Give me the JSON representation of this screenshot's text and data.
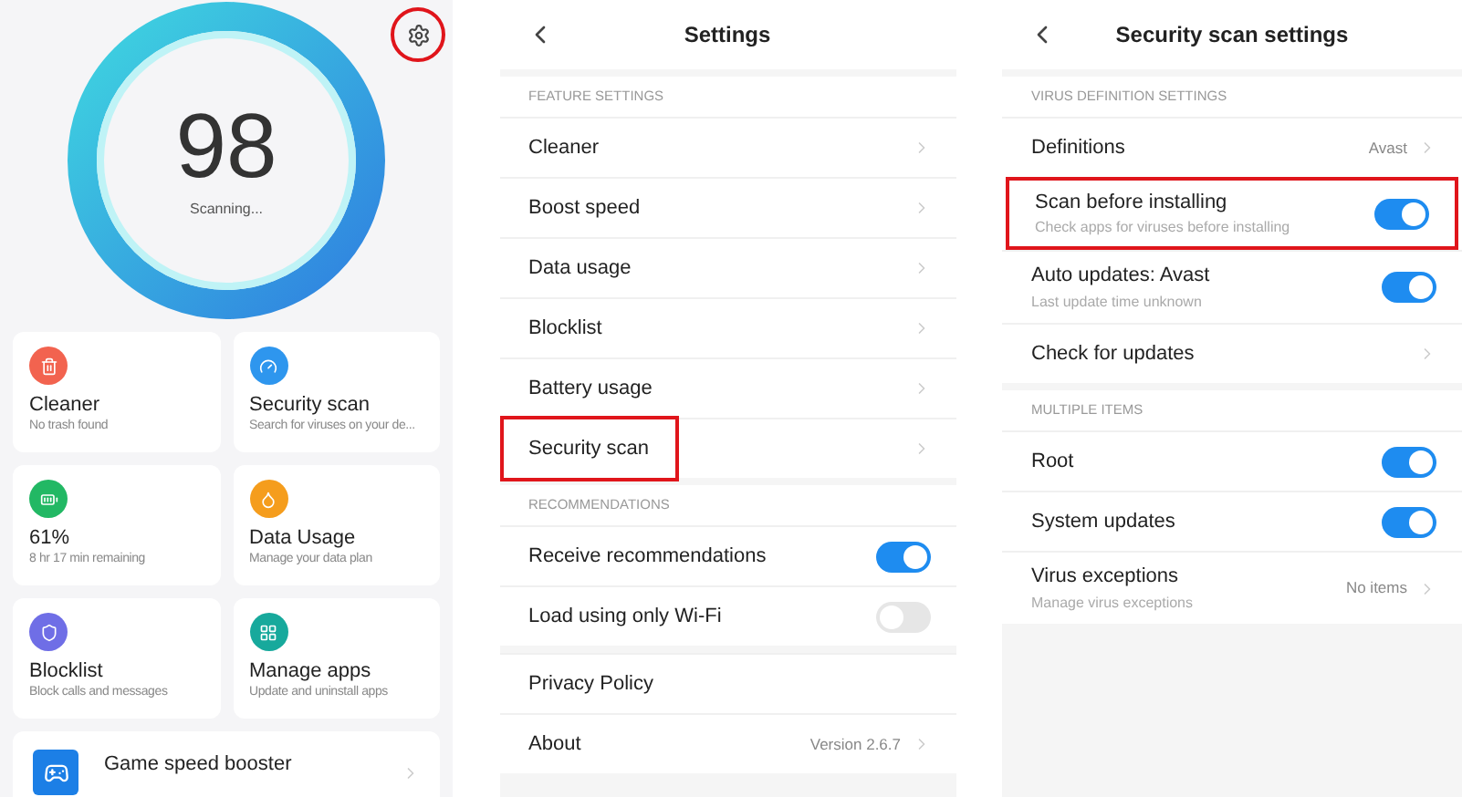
{
  "home": {
    "settings_highlighted": true,
    "score": "98",
    "status": "Scanning...",
    "tiles": [
      {
        "title": "Cleaner",
        "subtitle": "No trash found",
        "color": "#f2634f"
      },
      {
        "title": "Security scan",
        "subtitle": "Search for viruses on your de...",
        "color": "#2e96ee"
      },
      {
        "title": "61%",
        "subtitle": "8 hr 17 min  remaining",
        "color": "#22b864"
      },
      {
        "title": "Data Usage",
        "subtitle": "Manage your data plan",
        "color": "#f59d1d"
      },
      {
        "title": "Blocklist",
        "subtitle": "Block calls and messages",
        "color": "#6f6ee6"
      },
      {
        "title": "Manage apps",
        "subtitle": "Update and uninstall apps",
        "color": "#17a99c"
      }
    ],
    "booster": {
      "title": "Game speed booster"
    }
  },
  "settings": {
    "title": "Settings",
    "sections": [
      {
        "header": "FEATURE SETTINGS",
        "items": [
          {
            "kind": "link",
            "label": "Cleaner",
            "highlighted": false
          },
          {
            "kind": "link",
            "label": "Boost speed",
            "highlighted": false
          },
          {
            "kind": "link",
            "label": "Data usage",
            "highlighted": false
          },
          {
            "kind": "link",
            "label": "Blocklist",
            "highlighted": false
          },
          {
            "kind": "link",
            "label": "Battery usage",
            "highlighted": false
          },
          {
            "kind": "link",
            "label": "Security scan",
            "highlighted": true
          }
        ]
      },
      {
        "header": "RECOMMENDATIONS",
        "items": [
          {
            "kind": "toggle",
            "label": "Receive recommendations",
            "on": true
          },
          {
            "kind": "toggle",
            "label": "Load using only Wi-Fi",
            "on": false
          }
        ]
      },
      {
        "items": [
          {
            "kind": "plain",
            "label": "Privacy Policy"
          },
          {
            "kind": "link",
            "label": "About",
            "value": "Version 2.6.7",
            "highlighted": false
          }
        ]
      }
    ]
  },
  "scan_settings": {
    "title": "Security scan settings",
    "sections": [
      {
        "header": "VIRUS DEFINITION SETTINGS",
        "items": [
          {
            "kind": "link",
            "label": "Definitions",
            "value": "Avast",
            "highlighted": false
          },
          {
            "kind": "toggle",
            "label": "Scan before installing",
            "subtitle": "Check apps for viruses before installing",
            "on": true,
            "highlighted": true
          },
          {
            "kind": "toggle",
            "label": "Auto updates: Avast",
            "subtitle": "Last update time unknown",
            "on": true,
            "highlighted": false
          },
          {
            "kind": "link",
            "label": "Check for updates",
            "highlighted": false
          }
        ]
      },
      {
        "header": "MULTIPLE ITEMS",
        "items": [
          {
            "kind": "toggle",
            "label": "Root",
            "on": true,
            "highlighted": false
          },
          {
            "kind": "toggle",
            "label": "System updates",
            "on": true,
            "highlighted": false
          },
          {
            "kind": "link",
            "label": "Virus exceptions",
            "subtitle": "Manage virus exceptions",
            "value": "No items",
            "highlighted": false
          }
        ]
      }
    ]
  }
}
